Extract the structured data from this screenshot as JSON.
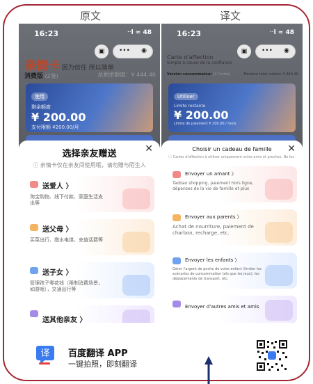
{
  "labels": {
    "original": "原文",
    "translated": "译文"
  },
  "original": {
    "time": "16:23",
    "status_icons": "ᐧᐧl ≈ 48",
    "brand_name": "亲情卡",
    "brand_slogan": "因为信任 所以简单",
    "tab_label": "消费版",
    "tab_count": "(2张)",
    "right_label": "总剩余额度：¥ 444.46",
    "card_pill": "使用",
    "card_label": "剩余额度",
    "card_amount": "¥ 200.00",
    "card_footer": "支付限额 ¥200.00/月",
    "sheet_title": "选择亲友赠送",
    "sheet_tip": "ⓘ 亲情卡仅在亲友间使用哦，请勿赠与陌生人",
    "options": [
      {
        "title": "送爱人  〉",
        "desc": "淘宝购物、线下付款、家庭生活支出等"
      },
      {
        "title": "送父母  〉",
        "desc": "买菜出行、缴水电煤、充值话费等"
      },
      {
        "title": "送子女  〉",
        "desc": "管理孩子零花钱（限制消费场景，如游戏），交通出行等"
      },
      {
        "title": "送其他亲友  〉",
        "desc": ""
      }
    ]
  },
  "translated": {
    "time": "16:23",
    "status_icons": "ᐧᐧl ≈ 48",
    "brand_name": "Carte d'affection",
    "brand_slogan": "Simple à cause de la confiance",
    "tab_label": "Version consommateur",
    "tab_count": "(2 Cartes)",
    "right_label": "Montant total restant: ¥ 444.46",
    "card_pill": "Utiliser",
    "card_label": "Limite restante",
    "card_amount": "¥ 200.00",
    "card_footer": "Limite de paiement ¥ 200.00 / mois",
    "sheet_title": "Choisir un cadeau de famille",
    "sheet_tip": "ⓘ Cartes d'affection à utiliser uniquement entre amis et proches. Ne les donnez pas à des étrangers.",
    "options": [
      {
        "title": "Envoyer un amant 〉",
        "desc": "Taobao shopping, paiement hors ligne, dépenses de la vie de famille et plus"
      },
      {
        "title": "Envoyer aux parents 〉",
        "desc": "Achat de nourriture, paiement de charbon, recharge, etc."
      },
      {
        "title": "Envoyer les enfants 〉",
        "desc": "Gérer l'argent de poche de votre enfant (limiter les scénarios de consommation tels que les jeux), les déplacements de transport, etc."
      },
      {
        "title": "Envoyer d'autres amis et amis",
        "desc": ""
      }
    ]
  },
  "footer": {
    "app_name": "百度翻译 APP",
    "tagline": "一键拍照，即刻翻译",
    "logo_char": "译"
  },
  "colors": {
    "frame": "#a32632",
    "brand": "#b7482e",
    "arrow": "#1c2f6e"
  }
}
